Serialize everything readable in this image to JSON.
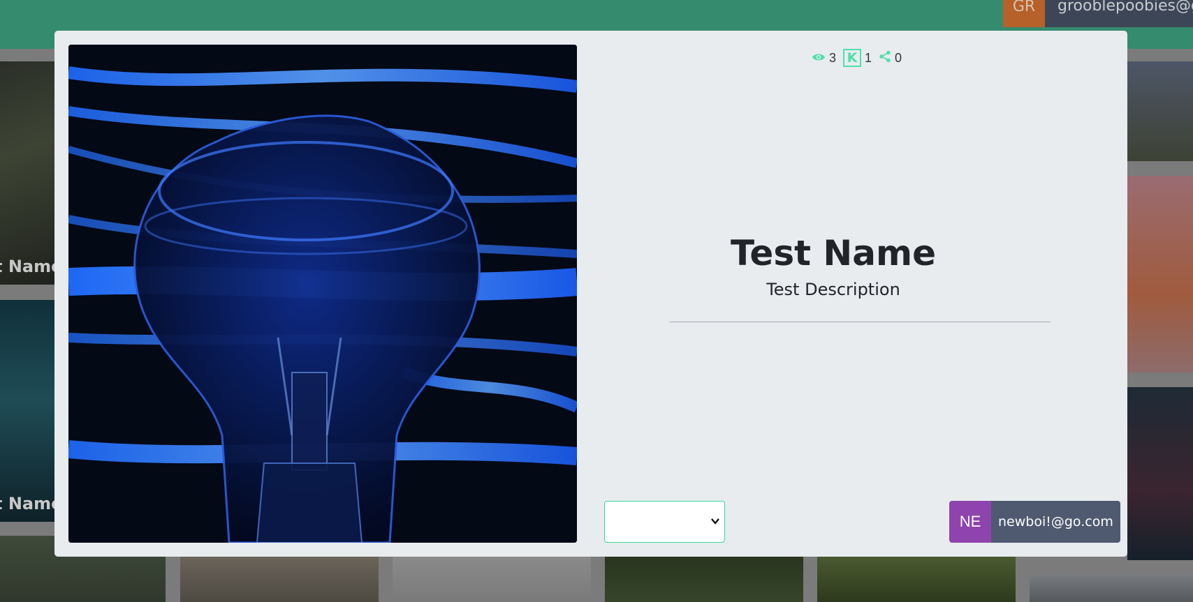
{
  "header": {
    "user_initials": "GR",
    "user_email": "grooblepoobies@gma"
  },
  "background": {
    "tile_caption_1": "t Name",
    "tile_caption_2": "t Name"
  },
  "modal": {
    "stats": {
      "views_icon": "eye-icon",
      "views": "3",
      "karma_icon": "k-icon",
      "karma_letter": "K",
      "karma": "1",
      "shares_icon": "share-icon",
      "shares": "0"
    },
    "title": "Test Name",
    "description": "Test Description",
    "select": {
      "selected_value": ""
    },
    "owner": {
      "initials": "NE",
      "email": "newboi!@go.com"
    }
  },
  "colors": {
    "accent": "#4fe0a8",
    "topbar": "#358b6d",
    "owner_initials_bg": "#8e44ad",
    "owner_email_bg": "#4f5a70",
    "header_initials_bg": "#b6602a"
  }
}
